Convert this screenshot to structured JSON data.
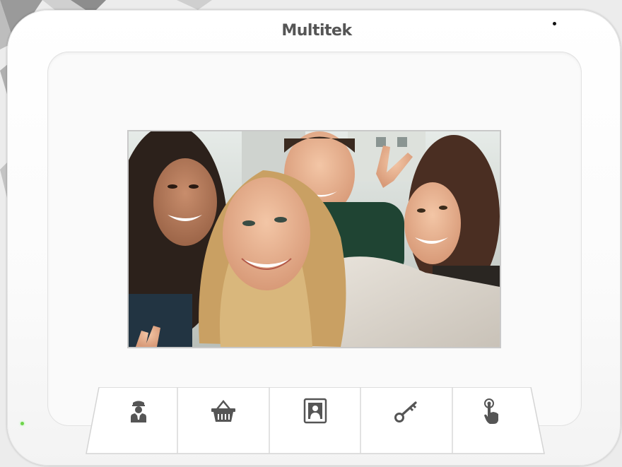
{
  "device": {
    "brand": "Multitek",
    "led_color": "#6fd34a"
  },
  "screen": {
    "content": "selfie-photo"
  },
  "buttons": [
    {
      "id": "concierge",
      "icon": "concierge-icon"
    },
    {
      "id": "shopping",
      "icon": "basket-icon"
    },
    {
      "id": "photo",
      "icon": "portrait-icon"
    },
    {
      "id": "door",
      "icon": "key-icon"
    },
    {
      "id": "touch",
      "icon": "touch-hand-icon"
    }
  ],
  "colors": {
    "icon": "#555555",
    "body": "#ffffff",
    "frame": "#c9c9c9"
  }
}
